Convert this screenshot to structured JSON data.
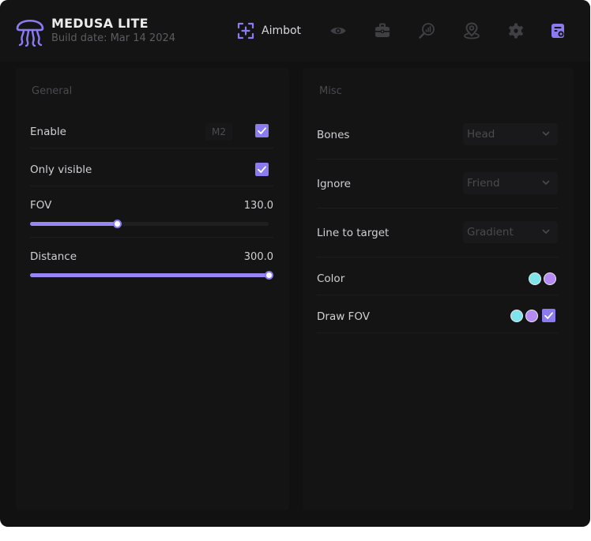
{
  "app": {
    "title": "MEDUSA LITE",
    "subtitle": "Build date: Mar 14 2024"
  },
  "nav": {
    "active_label": "Aimbot",
    "icons": [
      "crosshair-icon",
      "eye-icon",
      "briefcase-icon",
      "search-chart-icon",
      "map-pin-icon",
      "gear-icon",
      "config-icon"
    ]
  },
  "general": {
    "title": "General",
    "enable": {
      "label": "Enable",
      "keybind": "M2",
      "checked": true
    },
    "only_visible": {
      "label": "Only visible",
      "checked": true
    },
    "fov": {
      "label": "FOV",
      "value": "130.0",
      "fraction": 0.363
    },
    "distance": {
      "label": "Distance",
      "value": "300.0",
      "fraction": 1.0
    }
  },
  "misc": {
    "title": "Misc",
    "bones": {
      "label": "Bones",
      "value": "Head"
    },
    "ignore": {
      "label": "Ignore",
      "value": "Friend"
    },
    "line_to_target": {
      "label": "Line to target",
      "value": "Gradient"
    },
    "color": {
      "label": "Color",
      "colors": [
        "#7fe3ec",
        "#b68af5"
      ]
    },
    "draw_fov": {
      "label": "Draw FOV",
      "colors": [
        "#7fe3ec",
        "#b68af5"
      ],
      "checked": true
    }
  },
  "theme": {
    "accent": "#8b7bf0",
    "background": "#111112",
    "panel": "#141415"
  }
}
